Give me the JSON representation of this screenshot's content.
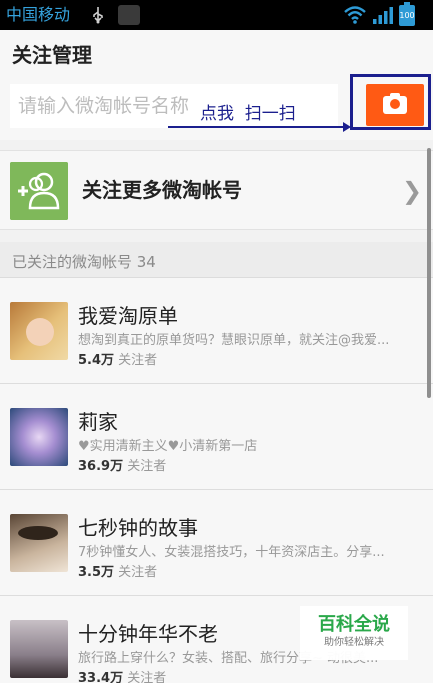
{
  "status_bar": {
    "carrier": "中国移动",
    "battery": "100",
    "accent": "#2e9bd6"
  },
  "header": {
    "title": "关注管理"
  },
  "search": {
    "placeholder": "请输入微淘帐号名称",
    "scan_icon": "camera-icon",
    "scan_color": "#ff5a14"
  },
  "annotation": {
    "text": "点我  扫一扫",
    "color": "#1b1f8e"
  },
  "follow_more": {
    "label": "关注更多微淘帐号",
    "icon": "add-user-icon"
  },
  "section": {
    "label": "已关注的微淘帐号 34"
  },
  "accounts": [
    {
      "name": "我爱淘原单",
      "desc": "想淘到真正的原单货吗？慧眼识原单，就关注@我爱...",
      "count": "5.4万",
      "count_label": "关注者"
    },
    {
      "name": "莉家",
      "desc": "♥实用清新主义♥小清新第一店",
      "count": "36.9万",
      "count_label": "关注者"
    },
    {
      "name": "七秒钟的故事",
      "desc": "7秒钟懂女人、女装混搭技巧，十年资深店主。分享...",
      "count": "3.5万",
      "count_label": "关注者"
    },
    {
      "name": "十分钟年华不老",
      "desc": "旅行路上穿什么？女装、搭配、旅行分享~ 动很美...",
      "count": "33.4万",
      "count_label": "关注者"
    }
  ],
  "watermark": {
    "title": "百科全说",
    "subtitle": "助你轻松解决"
  }
}
